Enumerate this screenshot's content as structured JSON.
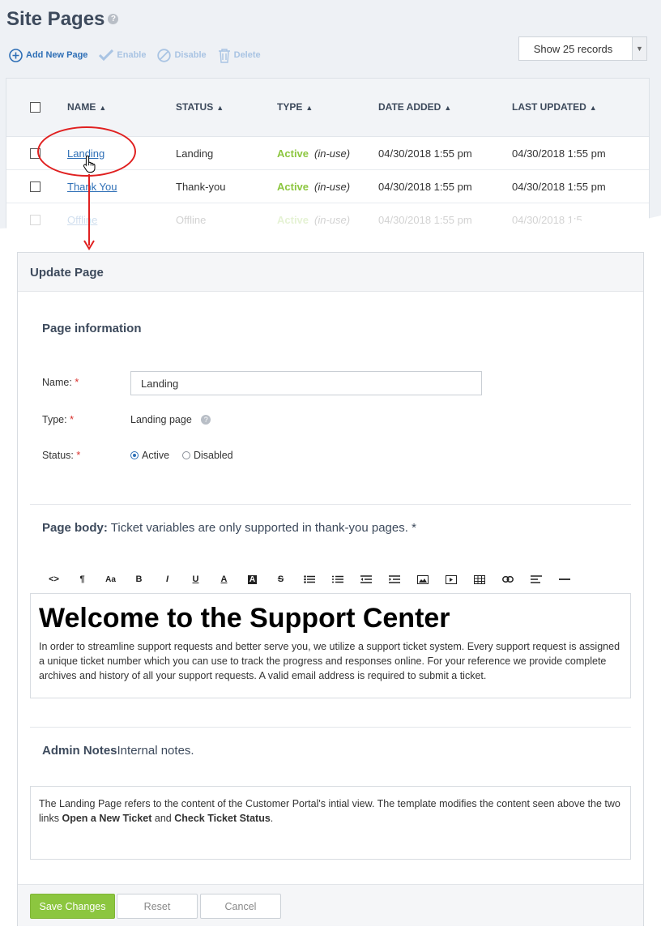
{
  "header": {
    "title": "Site Pages",
    "help_icon": "question-icon"
  },
  "toolbar": {
    "add_label": "Add New Page",
    "enable_label": "Enable",
    "disable_label": "Disable",
    "delete_label": "Delete"
  },
  "records_select": {
    "value": "Show 25 records"
  },
  "table": {
    "columns": [
      "NAME",
      "STATUS",
      "TYPE",
      "DATE ADDED",
      "LAST UPDATED"
    ],
    "rows": [
      {
        "name": "Landing",
        "status": "Landing",
        "type": "Active",
        "type_note": "(in-use)",
        "date_added": "04/30/2018 1:55 pm",
        "last_updated": "04/30/2018 1:55 pm"
      },
      {
        "name": "Thank You",
        "status": "Thank-you",
        "type": "Active",
        "type_note": "(in-use)",
        "date_added": "04/30/2018 1:55 pm",
        "last_updated": "04/30/2018 1:55 pm"
      },
      {
        "name": "Offline",
        "status": "Offline",
        "type": "Active",
        "type_note": "(in-use)",
        "date_added": "04/30/2018 1:55 pm",
        "last_updated": "04/30/2018 1:5"
      }
    ]
  },
  "update_page": {
    "title": "Update Page",
    "section_title": "Page information",
    "name_label": "Name:",
    "name_value": "Landing",
    "type_label": "Type:",
    "type_value": "Landing page",
    "status_label": "Status:",
    "status_options": [
      "Active",
      "Disabled"
    ],
    "required_mark": "*",
    "body_heading_bold": "Page body:",
    "body_heading_text": "Ticket variables are only supported in thank-you pages. *",
    "editor_tools": [
      "<>",
      "¶",
      "Aa",
      "B",
      "I",
      "U",
      "A",
      "A",
      "S",
      "ul",
      "ol",
      "outdent",
      "indent",
      "image",
      "video",
      "table",
      "link",
      "align",
      "hr"
    ],
    "editor_heading": "Welcome to the Support Center",
    "editor_paragraph": "In order to streamline support requests and better serve you, we utilize a support ticket system. Every support request is assigned a unique ticket number which you can use to track the progress and responses online. For your reference we provide complete archives and history of all your support requests. A valid email address is required to submit a ticket.",
    "notes_heading_bold": "Admin Notes",
    "notes_heading_text": "Internal notes.",
    "notes_text_1": "The Landing Page refers to the content of the Customer Portal's intial view. The template modifies the content seen above the two links ",
    "notes_bold_1": "Open a New Ticket",
    "notes_text_2": " and ",
    "notes_bold_2": "Check Ticket Status",
    "notes_text_3": ".",
    "save_label": "Save Changes",
    "reset_label": "Reset",
    "cancel_label": "Cancel"
  },
  "colors": {
    "accent": "#2e6fb6",
    "active_green": "#8cc63f",
    "annotation_red": "#e02020"
  }
}
